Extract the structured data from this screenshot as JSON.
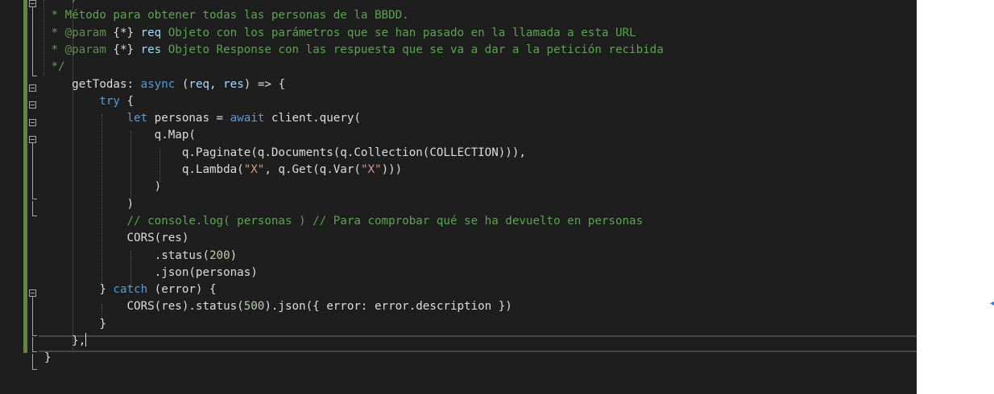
{
  "editor": {
    "language": "javascript",
    "theme": {
      "background": "#1e1e1e",
      "comment": "#57a64a",
      "keyword": "#569cd6",
      "string": "#d69d85",
      "number": "#b5cea8",
      "parameter": "#9cdcfe",
      "text": "#dcdcdc",
      "change_marker": "#5c8a3a"
    },
    "lines": [
      {
        "tokens": [
          {
            "t": "    ",
            "c": "p"
          },
          {
            "t": "/**",
            "c": "comment"
          }
        ]
      },
      {
        "tokens": [
          {
            "t": " * Método para obtener todas las personas de la BBDD.",
            "c": "comment"
          }
        ]
      },
      {
        "tokens": [
          {
            "t": " * ",
            "c": "comment"
          },
          {
            "t": "@param",
            "c": "doctag"
          },
          {
            "t": " {*} ",
            "c": "p"
          },
          {
            "t": "req",
            "c": "param"
          },
          {
            "t": " Objeto con los parámetros que se han pasado en la llamada a esta URL",
            "c": "comment"
          }
        ]
      },
      {
        "tokens": [
          {
            "t": " * ",
            "c": "comment"
          },
          {
            "t": "@param",
            "c": "doctag"
          },
          {
            "t": " {*} ",
            "c": "p"
          },
          {
            "t": "res",
            "c": "param"
          },
          {
            "t": " Objeto Response con las respuesta que se va a dar a la petición recibida",
            "c": "comment"
          }
        ]
      },
      {
        "tokens": [
          {
            "t": " */",
            "c": "comment"
          }
        ]
      },
      {
        "tokens": [
          {
            "t": "    getTodas",
            "c": "p"
          },
          {
            "t": ": ",
            "c": "p"
          },
          {
            "t": "async",
            "c": "kw"
          },
          {
            "t": " (",
            "c": "p"
          },
          {
            "t": "req",
            "c": "param"
          },
          {
            "t": ", ",
            "c": "p"
          },
          {
            "t": "res",
            "c": "param"
          },
          {
            "t": ") => {",
            "c": "p"
          }
        ]
      },
      {
        "tokens": [
          {
            "t": "        ",
            "c": "p"
          },
          {
            "t": "try",
            "c": "kw"
          },
          {
            "t": " {",
            "c": "p"
          }
        ]
      },
      {
        "tokens": [
          {
            "t": "            ",
            "c": "p"
          },
          {
            "t": "let",
            "c": "kw"
          },
          {
            "t": " personas = ",
            "c": "p"
          },
          {
            "t": "await",
            "c": "kw"
          },
          {
            "t": " client.query(",
            "c": "p"
          }
        ]
      },
      {
        "tokens": [
          {
            "t": "                q.Map(",
            "c": "p"
          }
        ]
      },
      {
        "tokens": [
          {
            "t": "                    q.Paginate(q.Documents(q.Collection(COLLECTION))),",
            "c": "p"
          }
        ]
      },
      {
        "tokens": [
          {
            "t": "                    q.Lambda(",
            "c": "p"
          },
          {
            "t": "\"X\"",
            "c": "str"
          },
          {
            "t": ", q.Get(q.Var(",
            "c": "p"
          },
          {
            "t": "\"X\"",
            "c": "str"
          },
          {
            "t": ")))",
            "c": "p"
          }
        ]
      },
      {
        "tokens": [
          {
            "t": "                )",
            "c": "p"
          }
        ]
      },
      {
        "tokens": [
          {
            "t": "            )",
            "c": "p"
          }
        ]
      },
      {
        "tokens": [
          {
            "t": "            ",
            "c": "p"
          },
          {
            "t": "// console.log( personas ) // Para comprobar qué se ha devuelto en personas",
            "c": "comment"
          }
        ]
      },
      {
        "tokens": [
          {
            "t": "            CORS(res)",
            "c": "p"
          }
        ]
      },
      {
        "tokens": [
          {
            "t": "                .status(",
            "c": "p"
          },
          {
            "t": "200",
            "c": "num"
          },
          {
            "t": ")",
            "c": "p"
          }
        ]
      },
      {
        "tokens": [
          {
            "t": "                .json(personas)",
            "c": "p"
          }
        ]
      },
      {
        "tokens": [
          {
            "t": "        } ",
            "c": "p"
          },
          {
            "t": "catch",
            "c": "kw"
          },
          {
            "t": " (error) {",
            "c": "p"
          }
        ]
      },
      {
        "tokens": [
          {
            "t": "            CORS(res).status(",
            "c": "p"
          },
          {
            "t": "500",
            "c": "num"
          },
          {
            "t": ").json({ error: error.description })",
            "c": "p"
          }
        ]
      },
      {
        "tokens": [
          {
            "t": "        }",
            "c": "p"
          }
        ]
      },
      {
        "tokens": [
          {
            "t": "    },",
            "c": "p"
          }
        ],
        "cursor": true
      },
      {
        "tokens": [
          {
            "t": "}",
            "c": "p"
          }
        ]
      }
    ]
  }
}
